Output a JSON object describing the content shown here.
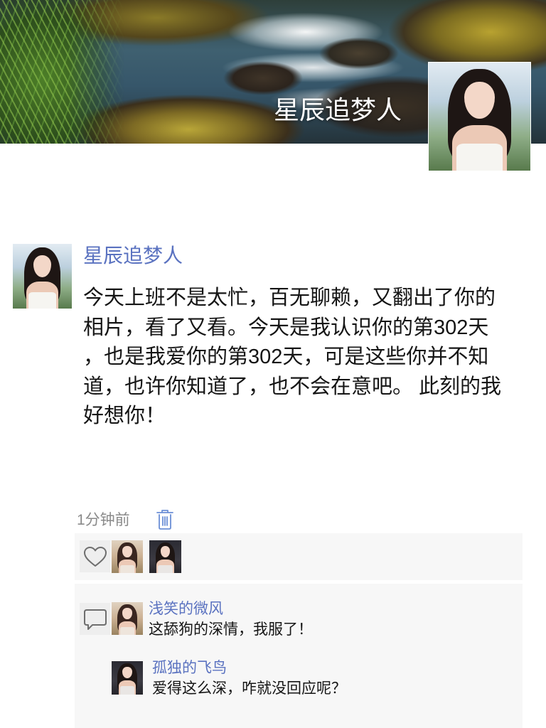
{
  "cover": {
    "display_name": "星辰追梦人"
  },
  "post": {
    "author": "星辰追梦人",
    "text_lines": [
      "今天上班不是太忙，百无聊赖，又翻出了你的",
      "相片，看了又看。今天是我认识你的第302天",
      "，也是我爱你的第302天，可是这些你并不知",
      "道，也许你知道了，也不会在意吧。 此刻的我",
      "好想你！"
    ],
    "time": "1分钟前"
  },
  "comments": [
    {
      "author": "浅笑的微风",
      "text": "这舔狗的深情，我服了！"
    },
    {
      "author": "孤独的飞鸟",
      "text": "爱得这么深，咋就没回应呢？"
    }
  ],
  "icons": {
    "like": "heart-icon",
    "comment": "comment-icon",
    "delete": "trash-icon"
  },
  "colors": {
    "name_link": "#5a72c0",
    "panel_background": "#f7f7f7",
    "delete_icon": "#6b8fd6",
    "body_text": "#151515",
    "time_text": "#8a8a8a"
  }
}
